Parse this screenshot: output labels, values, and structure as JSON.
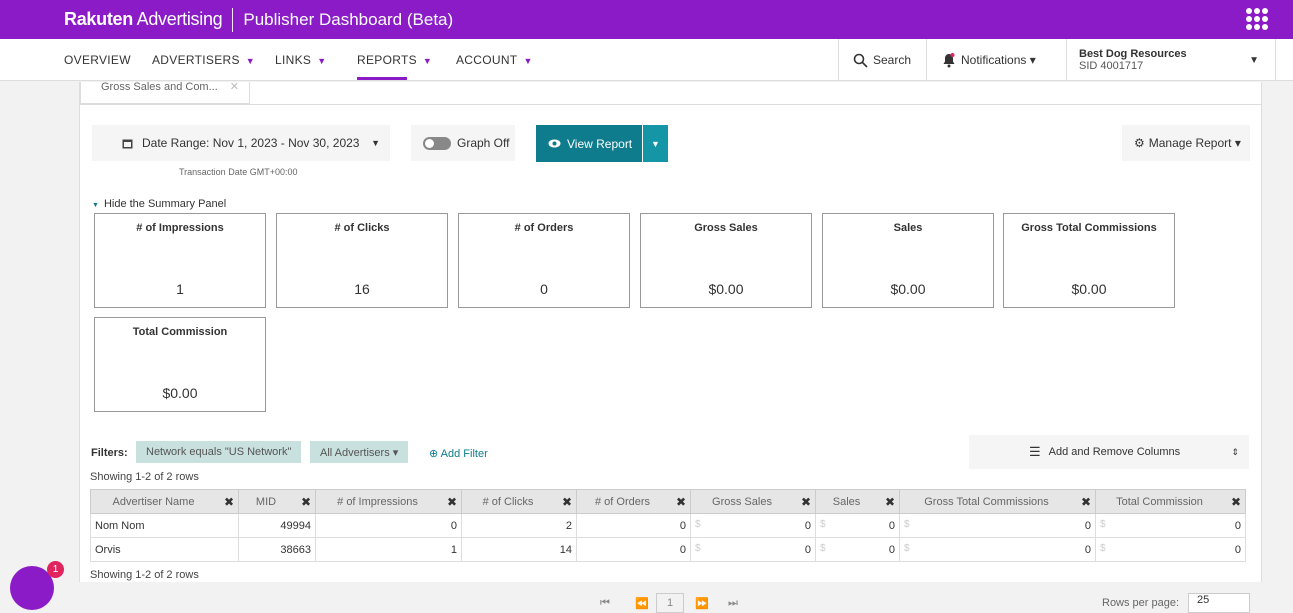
{
  "header": {
    "brand_bold": "Rakuten",
    "brand_rest": " Advertising",
    "app_title": "Publisher Dashboard (Beta)",
    "apps_icon": "grid-icon"
  },
  "nav": {
    "items": [
      {
        "label": "OVERVIEW",
        "caret": ""
      },
      {
        "label": "ADVERTISERS",
        "caret": "▼"
      },
      {
        "label": "LINKS",
        "caret": "▼"
      },
      {
        "label": "REPORTS",
        "caret": "▼"
      },
      {
        "label": "ACCOUNT",
        "caret": "▼"
      }
    ],
    "active": "REPORTS",
    "search_label": "Search",
    "notifications_label": "Notifications ▾",
    "account_name": "Best Dog Resources",
    "account_sid": "SID 4001717"
  },
  "tab": {
    "label": "Gross Sales and Com...",
    "close": "✕"
  },
  "toolbar": {
    "date_range": "Date Range: Nov 1, 2023 - Nov 30, 2023",
    "tz_note": "Transaction Date GMT+00:00",
    "graph_label": "Graph Off",
    "view_report": "View Report",
    "manage_report": "Manage Report ▾"
  },
  "summary": {
    "toggle_label": "Hide the Summary Panel",
    "cards": [
      {
        "label": "# of Impressions",
        "value": "1"
      },
      {
        "label": "# of Clicks",
        "value": "16"
      },
      {
        "label": "# of Orders",
        "value": "0"
      },
      {
        "label": "Gross Sales",
        "value": "$0.00"
      },
      {
        "label": "Sales",
        "value": "$0.00"
      },
      {
        "label": "Gross Total Commissions",
        "value": "$0.00"
      },
      {
        "label": "Total Commission",
        "value": "$0.00"
      }
    ]
  },
  "filters": {
    "label": "Filters:",
    "chip1": "Network equals \"US Network\"",
    "chip2": "All Advertisers ▾",
    "add": "Add Filter",
    "columns_btn": "Add and Remove Columns"
  },
  "table": {
    "showing": "Showing 1-2 of 2 rows",
    "headers": [
      "Advertiser Name",
      "MID",
      "# of Impressions",
      "# of Clicks",
      "# of Orders",
      "Gross Sales",
      "Sales",
      "Gross Total Commissions",
      "Total Commission"
    ],
    "rows": [
      [
        "Nom Nom",
        "49994",
        "0",
        "2",
        "0",
        "0",
        "0",
        "0",
        "0"
      ],
      [
        "Orvis",
        "38663",
        "1",
        "14",
        "0",
        "0",
        "0",
        "0",
        "0"
      ]
    ],
    "currency_symbol": "$"
  },
  "pagination": {
    "current_page": "1",
    "rows_per_page_label": "Rows per page:",
    "rows_per_page": "25"
  },
  "chat": {
    "badge": "1"
  },
  "colors": {
    "brand_purple": "#8a1bc6",
    "teal": "#0e7c8c"
  }
}
